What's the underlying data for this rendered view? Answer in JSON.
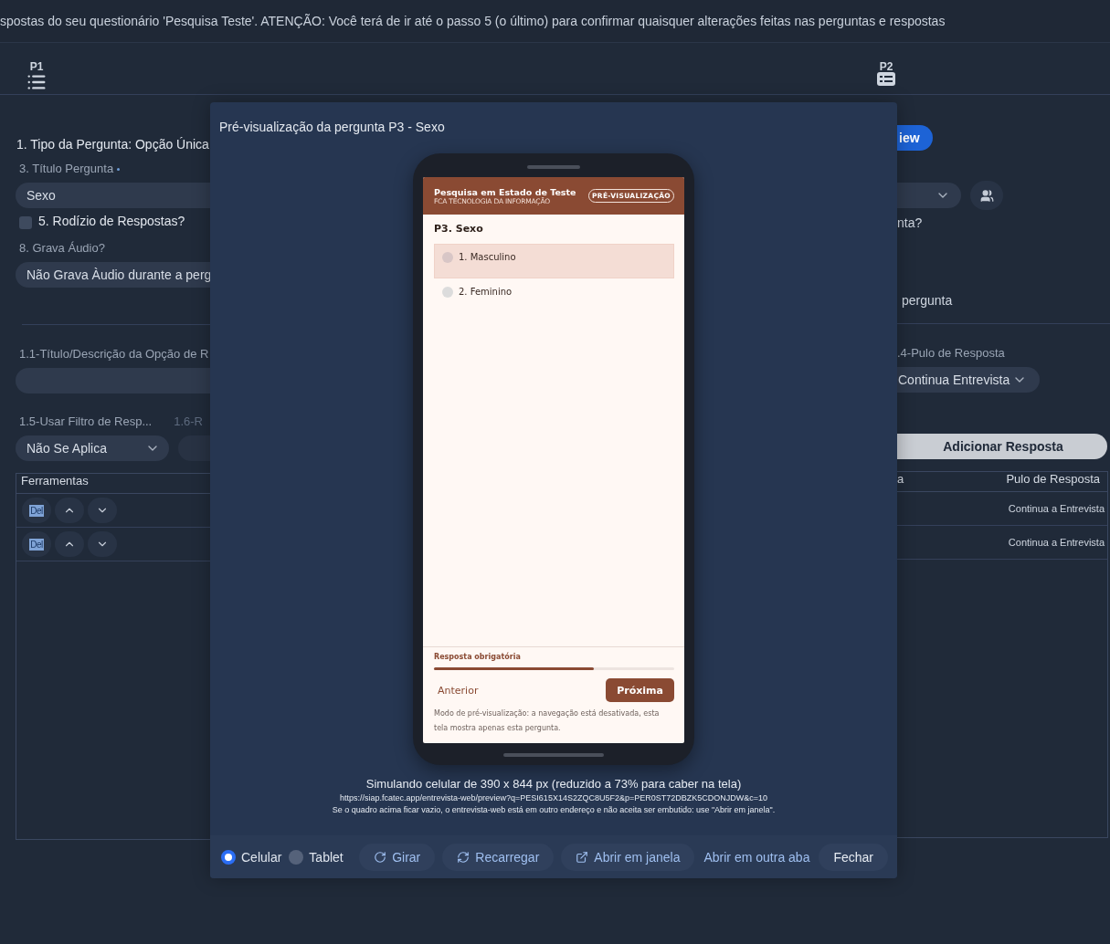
{
  "banner": "spostas do seu questionário 'Pesquisa Teste'. ATENÇÃO: Você terá de ir até o passo 5 (o último) para confirmar quaisquer alterações feitas nas perguntas e respostas",
  "nav": [
    {
      "label": "P1",
      "kind": "list"
    },
    {
      "label": "P2",
      "kind": "card"
    }
  ],
  "left": {
    "type_line": "1. Tipo da Pergunta: Opção Única",
    "title_label": "3. Título Pergunta",
    "title_value": "Sexo",
    "rotation": {
      "label": "5. Rodízio de Respostas?",
      "checked": false
    },
    "audio_label": "8. Grava Áudio?",
    "audio_value": "Não Grava Àudio durante a perg",
    "option_label": "1.1-Título/Descrição da Opção de R",
    "filter_label": "1.5-Usar Filtro de Resp...",
    "filter_value": "Não Se Aplica",
    "column_6_label": "1.6-R"
  },
  "right": {
    "view_button": "iew",
    "question_tail": "nta?",
    "audio_tail": "pergunta",
    "jump_label": ".4-Pulo de Resposta",
    "jump_value": "Continua Entrevista",
    "add_button": "Adicionar Resposta"
  },
  "table": {
    "columns": [
      "Ferramentas",
      "a",
      "Pulo de Resposta"
    ],
    "rows": [
      {
        "delete": "Del",
        "jump": "Continua a Entrevista"
      },
      {
        "delete": "Del",
        "jump": "Continua a Entrevista"
      }
    ]
  },
  "preview": {
    "title": "Pré-visualização da pergunta P3 - Sexo",
    "survey_title": "Pesquisa em Estado de Teste",
    "company": "FCA TECNOLOGIA DA INFORMAÇÃO",
    "badge": "PRÉ-VISUALIZAÇÃO",
    "question": "P3. Sexo",
    "options": [
      {
        "label": "1. Masculino",
        "highlighted": true
      },
      {
        "label": "2. Feminino",
        "highlighted": false
      }
    ],
    "required_label": "Resposta obrigatória",
    "progress": {
      "level": 0.665
    },
    "back_button": "Anterior",
    "next_button": "Próxima",
    "note": "Modo de pré-visualização: a navegação está desativada, esta tela mostra apenas esta pergunta.",
    "caption": "Simulando celular de 390 x 844 px (reduzido a 73% para caber na tela)",
    "url": "https://siap.fcatec.app/entrevista-web/preview?q=PESI615X14S2ZQC8U5F2&p=PER0ST72DBZK5CDONJDW&c=10",
    "hint": "Se o quadro acima ficar vazio, o entrevista-web está em outro endereço e não aceita ser embutido: use \"Abrir em janela\".",
    "devices": [
      {
        "label": "Celular",
        "selected": true
      },
      {
        "label": "Tablet",
        "selected": false
      }
    ],
    "actions": [
      {
        "kind": "rotate",
        "label": "Girar"
      },
      {
        "kind": "reload",
        "label": "Recarregar"
      },
      {
        "kind": "window",
        "label": "Abrir em janela"
      },
      {
        "kind": "link",
        "label": "Abrir em outra aba"
      },
      {
        "kind": "close",
        "label": "Fechar"
      }
    ]
  }
}
